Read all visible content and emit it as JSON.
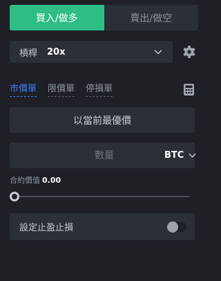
{
  "side_tabs": {
    "buy_label": "買入/做多",
    "sell_label": "賣出/做空"
  },
  "leverage": {
    "label": "槓桿",
    "value": "20x"
  },
  "order_types": [
    "市價單",
    "限價單",
    "停損單"
  ],
  "price": {
    "text": "以當前最優價"
  },
  "quantity": {
    "placeholder": "數量",
    "unit": "BTC"
  },
  "contract_value": {
    "label": "合約價值",
    "value": "0.00"
  },
  "slider": {
    "value": 0
  },
  "tpsl": {
    "label": "設定止盈止損",
    "enabled": false
  },
  "colors": {
    "buy": "#2ebd85",
    "active_tab": "#3d7bf5",
    "panel_bg": "#1e2026",
    "field_bg": "#2b2f36"
  },
  "icons": {
    "leverage_dropdown": "chevron-down-icon",
    "settings": "gear-icon",
    "calculator": "calculator-icon",
    "unit_dropdown": "chevron-down-icon"
  }
}
